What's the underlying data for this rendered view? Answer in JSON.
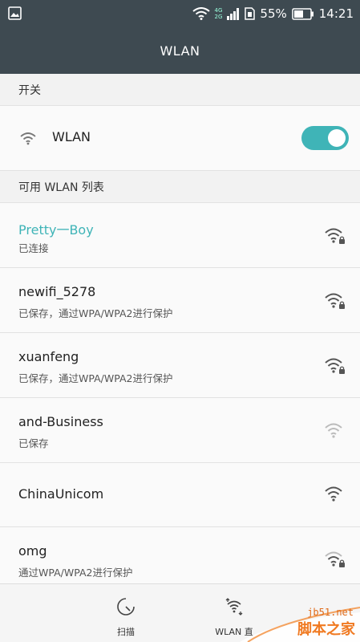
{
  "status_bar": {
    "battery_percent": "55%",
    "time": "14:21",
    "network_label_top": "4G",
    "network_label_bottom": "2G",
    "icons": [
      "image-icon",
      "wifi-icon",
      "signal-icon",
      "sim-icon",
      "battery-icon"
    ]
  },
  "title": "WLAN",
  "switch_section": {
    "header": "开关",
    "label": "WLAN",
    "enabled": true,
    "accent_color": "#3fb4b7"
  },
  "list_section": {
    "header": "可用 WLAN 列表"
  },
  "networks": [
    {
      "name": "Pretty一Boy",
      "status": "已连接",
      "connected": true,
      "locked": true,
      "signal": "strong"
    },
    {
      "name": "newifi_5278",
      "status": "已保存，通过WPA/WPA2进行保护",
      "connected": false,
      "locked": true,
      "signal": "strong"
    },
    {
      "name": "xuanfeng",
      "status": "已保存，通过WPA/WPA2进行保护",
      "connected": false,
      "locked": true,
      "signal": "strong"
    },
    {
      "name": "and-Business",
      "status": "已保存",
      "connected": false,
      "locked": false,
      "signal": "weak"
    },
    {
      "name": "ChinaUnicom",
      "status": "",
      "connected": false,
      "locked": false,
      "signal": "strong"
    },
    {
      "name": "omg",
      "status": "通过WPA/WPA2进行保护",
      "connected": false,
      "locked": true,
      "signal": "medium"
    }
  ],
  "bottom_tabs": [
    {
      "label": "扫描",
      "icon": "scan-icon"
    },
    {
      "label": "WLAN 直",
      "icon": "wlan-direct-icon"
    }
  ],
  "watermark": {
    "url": "jb51.net",
    "text": "脚本之家"
  }
}
